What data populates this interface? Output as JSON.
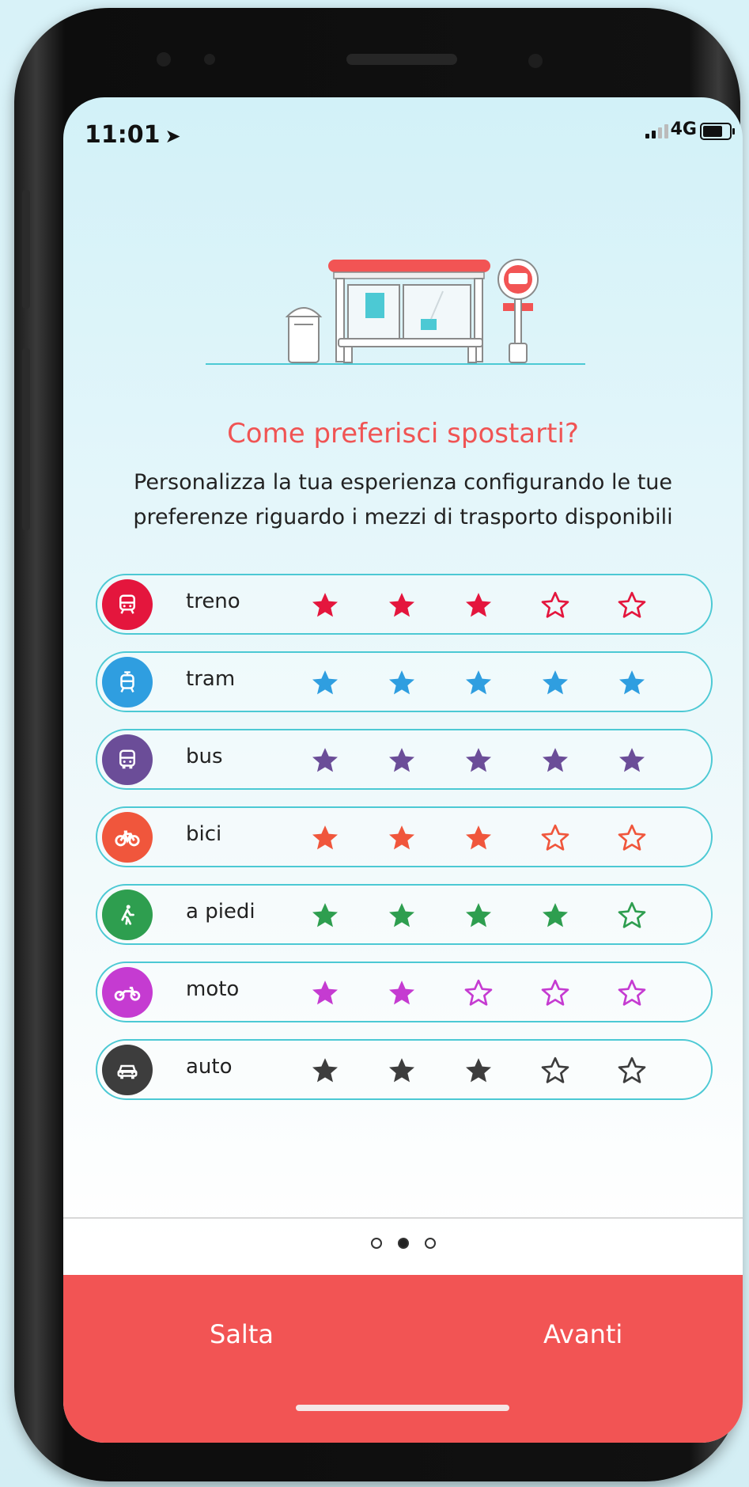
{
  "status_bar": {
    "time": "11:01",
    "network": "4G"
  },
  "onboarding": {
    "title": "Come preferisci spostarti?",
    "subtitle_line1": "Personalizza la tua esperienza configurando le tue",
    "subtitle_line2": "preferenze riguardo i mezzi di trasporto disponibili"
  },
  "transport_modes": [
    {
      "label": "treno",
      "icon": "train-icon",
      "color": "#e4163d",
      "rating": 3,
      "max": 5
    },
    {
      "label": "tram",
      "icon": "tram-icon",
      "color": "#2f9ee0",
      "rating": 5,
      "max": 5
    },
    {
      "label": "bus",
      "icon": "bus-icon",
      "color": "#6b4d98",
      "rating": 5,
      "max": 5
    },
    {
      "label": "bici",
      "icon": "bicycle-icon",
      "color": "#f0563c",
      "rating": 3,
      "max": 5
    },
    {
      "label": "a piedi",
      "icon": "walking-icon",
      "color": "#2e9e4f",
      "rating": 4,
      "max": 5
    },
    {
      "label": "moto",
      "icon": "motorcycle-icon",
      "color": "#c53bd1",
      "rating": 2,
      "max": 5
    },
    {
      "label": "auto",
      "icon": "car-icon",
      "color": "#3d3d3d",
      "rating": 3,
      "max": 5
    }
  ],
  "pager": {
    "pages": 3,
    "current": 2
  },
  "footer": {
    "skip_label": "Salta",
    "next_label": "Avanti"
  },
  "colors": {
    "accent": "#f25454",
    "row_border": "#4cc9d4",
    "title": "#f05454"
  }
}
